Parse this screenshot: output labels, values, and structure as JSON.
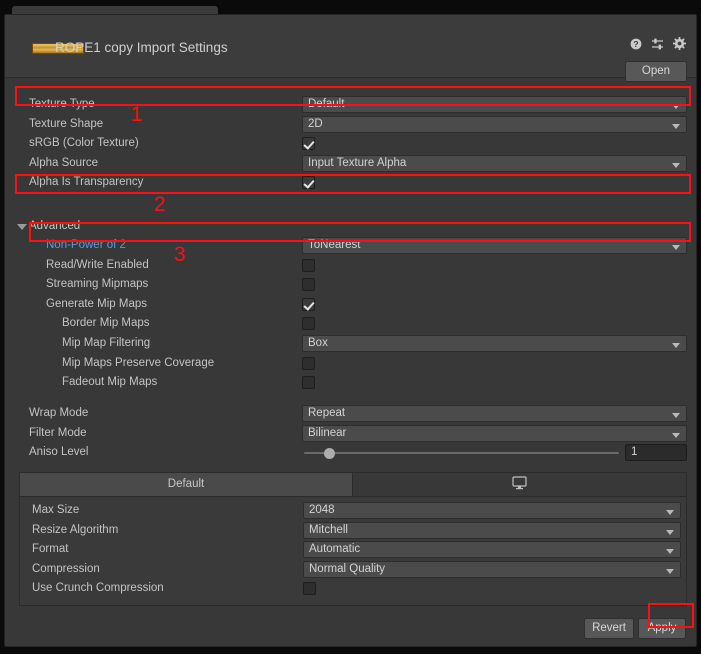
{
  "header": {
    "title": "ROPE1 copy Import Settings",
    "open_label": "Open",
    "icons": [
      "help-icon",
      "preset-icon",
      "gear-icon"
    ],
    "thumbnail": "rope-texture-thumbnail"
  },
  "main_rows": [
    {
      "label": "Texture Type",
      "indent": 0,
      "type": "dropdown",
      "value": "Default"
    },
    {
      "label": "Texture Shape",
      "indent": 0,
      "type": "dropdown",
      "value": "2D"
    },
    {
      "label": "sRGB (Color Texture)",
      "indent": 0,
      "type": "checkbox",
      "checked": true
    },
    {
      "label": "Alpha Source",
      "indent": 0,
      "type": "dropdown",
      "value": "Input Texture Alpha"
    },
    {
      "label": "Alpha Is Transparency",
      "indent": 0,
      "type": "checkbox",
      "checked": true
    }
  ],
  "advanced": {
    "label": "Advanced",
    "expanded": true,
    "rows": [
      {
        "label": "Non-Power of 2",
        "indent": 1,
        "type": "dropdown",
        "value": "ToNearest",
        "label_color": "#5b9bd5"
      },
      {
        "label": "Read/Write Enabled",
        "indent": 1,
        "type": "checkbox",
        "checked": false
      },
      {
        "label": "Streaming Mipmaps",
        "indent": 1,
        "type": "checkbox",
        "checked": false
      },
      {
        "label": "Generate Mip Maps",
        "indent": 1,
        "type": "checkbox",
        "checked": true
      },
      {
        "label": "Border Mip Maps",
        "indent": 2,
        "type": "checkbox",
        "checked": false
      },
      {
        "label": "Mip Map Filtering",
        "indent": 2,
        "type": "dropdown",
        "value": "Box"
      },
      {
        "label": "Mip Maps Preserve Coverage",
        "indent": 2,
        "type": "checkbox",
        "checked": false
      },
      {
        "label": "Fadeout Mip Maps",
        "indent": 2,
        "type": "checkbox",
        "checked": false
      }
    ]
  },
  "sampling_rows": [
    {
      "label": "Wrap Mode",
      "indent": 0,
      "type": "dropdown",
      "value": "Repeat"
    },
    {
      "label": "Filter Mode",
      "indent": 0,
      "type": "dropdown",
      "value": "Bilinear"
    }
  ],
  "aniso": {
    "label": "Aniso Level",
    "value": "1",
    "slider_percent": 6
  },
  "platform": {
    "tabs": [
      {
        "label": "Default",
        "selected": true
      },
      {
        "label": "",
        "icon": "monitor-icon",
        "selected": false
      }
    ],
    "rows": [
      {
        "label": "Max Size",
        "type": "dropdown",
        "value": "2048"
      },
      {
        "label": "Resize Algorithm",
        "type": "dropdown",
        "value": "Mitchell"
      },
      {
        "label": "Format",
        "type": "dropdown",
        "value": "Automatic"
      },
      {
        "label": "Compression",
        "type": "dropdown",
        "value": "Normal Quality"
      },
      {
        "label": "Use Crunch Compression",
        "type": "checkbox",
        "checked": false
      }
    ]
  },
  "footer": {
    "revert_label": "Revert",
    "apply_label": "Apply"
  },
  "annotations": {
    "highlight_color": "#ff1010",
    "markers": [
      {
        "number": "1",
        "target": "Texture Type"
      },
      {
        "number": "2",
        "target": "Alpha Is Transparency"
      },
      {
        "number": "3",
        "target": "Non-Power of 2"
      }
    ]
  }
}
